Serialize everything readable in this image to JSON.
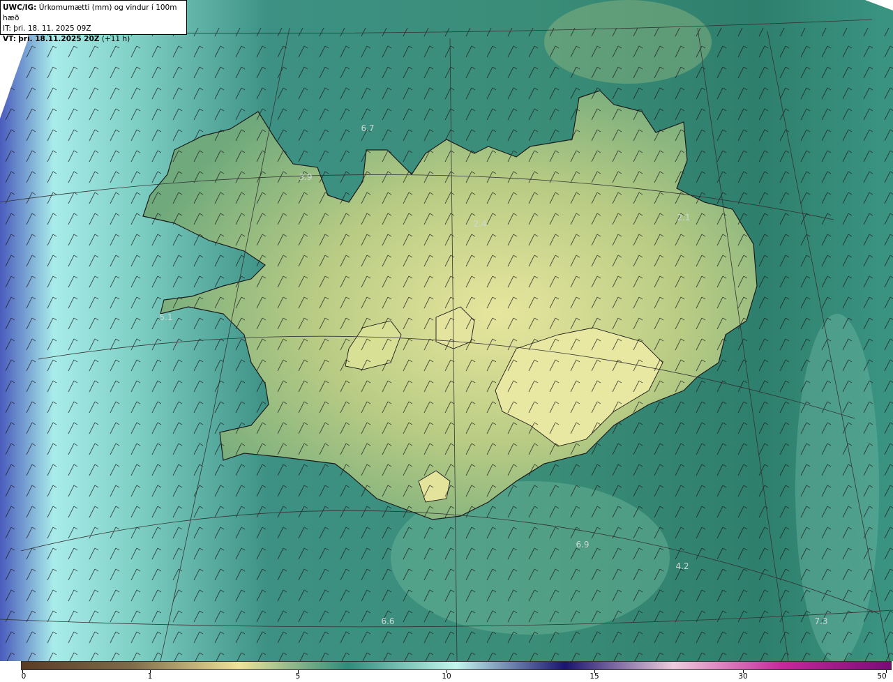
{
  "header": {
    "model": "UWC/IG:",
    "description": "Úrkomumætti (mm) og vindur í 100m hæð",
    "it_label": "IT:",
    "it_value": "þri. 18. 11. 2025 09Z",
    "vt_label": "VT:",
    "vt_value": "þri. 18.11.2025 20Z",
    "vt_offset": "(+11 h)"
  },
  "map_labels": [
    {
      "text": "6.7"
    },
    {
      "text": "3.9"
    },
    {
      "text": "2.4"
    },
    {
      "text": "2.1"
    },
    {
      "text": "5.1"
    },
    {
      "text": "6.9"
    },
    {
      "text": "4.2"
    },
    {
      "text": "6.6"
    },
    {
      "text": "7.3"
    }
  ],
  "colorbar": {
    "ticks": [
      {
        "label": "0",
        "value": 0
      },
      {
        "label": "1",
        "value": 1
      },
      {
        "label": "5",
        "value": 5
      },
      {
        "label": "10",
        "value": 10
      },
      {
        "label": "15",
        "value": 15
      },
      {
        "label": "30",
        "value": 30
      },
      {
        "label": "50",
        "value": 50
      }
    ],
    "colors": [
      "#5a3c25",
      "#7f6a4a",
      "#f0e39a",
      "#2f8c7b",
      "#c4f6ee",
      "#1a1470",
      "#eeccdd",
      "#c6289b",
      "#7a0b78"
    ]
  },
  "palette": {
    "sea": "#2e7c6f",
    "land": "#a9c57e",
    "highland": "#dfe59c",
    "west_sea": "#bef1e9",
    "deep_west": "#4a58b8",
    "coast": "#1b1b1b"
  }
}
